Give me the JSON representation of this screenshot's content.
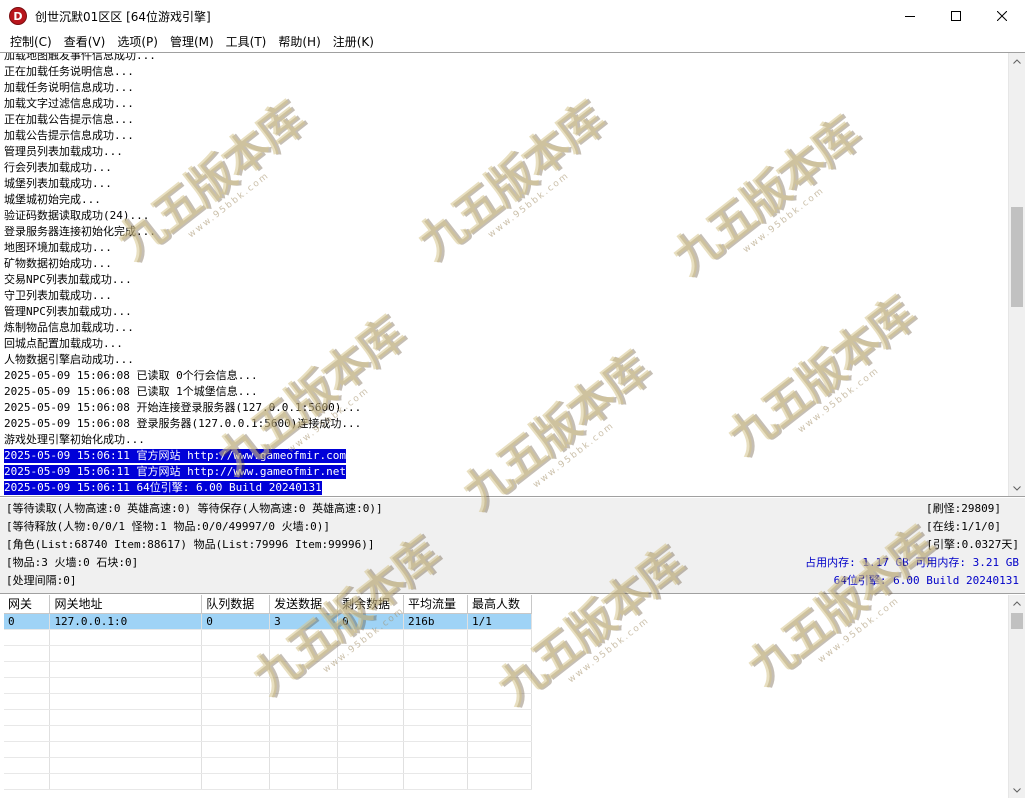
{
  "window": {
    "title": "创世沉默01区区 [64位游戏引擎]",
    "app_icon_glyph": "D"
  },
  "menu": [
    {
      "label": "控制(C)"
    },
    {
      "label": "查看(V)"
    },
    {
      "label": "选项(P)"
    },
    {
      "label": "管理(M)"
    },
    {
      "label": "工具(T)"
    },
    {
      "label": "帮助(H)"
    },
    {
      "label": "注册(K)"
    }
  ],
  "log": {
    "lines": [
      {
        "text": "加载地图触发事件信息成功...",
        "selected": false
      },
      {
        "text": "正在加载任务说明信息...",
        "selected": false
      },
      {
        "text": "加载任务说明信息成功...",
        "selected": false
      },
      {
        "text": "加载文字过滤信息成功...",
        "selected": false
      },
      {
        "text": "正在加载公告提示信息...",
        "selected": false
      },
      {
        "text": "加载公告提示信息成功...",
        "selected": false
      },
      {
        "text": "管理员列表加载成功...",
        "selected": false
      },
      {
        "text": "行会列表加载成功...",
        "selected": false
      },
      {
        "text": "城堡列表加载成功...",
        "selected": false
      },
      {
        "text": "城堡城初始完成...",
        "selected": false
      },
      {
        "text": "验证码数据读取成功(24)...",
        "selected": false
      },
      {
        "text": "登录服务器连接初始化完成...",
        "selected": false
      },
      {
        "text": "地图环境加载成功...",
        "selected": false
      },
      {
        "text": "矿物数据初始成功...",
        "selected": false
      },
      {
        "text": "交易NPC列表加载成功...",
        "selected": false
      },
      {
        "text": "守卫列表加载成功...",
        "selected": false
      },
      {
        "text": "管理NPC列表加载成功...",
        "selected": false
      },
      {
        "text": "炼制物品信息加载成功...",
        "selected": false
      },
      {
        "text": "回城点配置加载成功...",
        "selected": false
      },
      {
        "text": "人物数据引擎启动成功...",
        "selected": false
      },
      {
        "text": "2025-05-09 15:06:08 已读取 0个行会信息...",
        "selected": false
      },
      {
        "text": "2025-05-09 15:06:08 已读取 1个城堡信息...",
        "selected": false
      },
      {
        "text": "2025-05-09 15:06:08 开始连接登录服务器(127.0.0.1:5600)...",
        "selected": false
      },
      {
        "text": "2025-05-09 15:06:08 登录服务器(127.0.0.1:5600)连接成功...",
        "selected": false
      },
      {
        "text": "游戏处理引擎初始化成功...",
        "selected": false
      },
      {
        "text": "2025-05-09 15:06:11 官方网站 http://www.gameofmir.com",
        "selected": true
      },
      {
        "text": "2025-05-09 15:06:11 官方网站 http://www.gameofmir.net",
        "selected": true
      },
      {
        "text": "2025-05-09 15:06:11 64位引擎: 6.00 Build 20240131",
        "selected": true
      }
    ]
  },
  "status": {
    "row1_left": "[等待读取(人物高速:0 英雄高速:0) 等待保存(人物高速:0 英雄高速:0)]",
    "row2_left": "[等待释放(人物:0/0/1 怪物:1 物品:0/0/49997/0 火墙:0)]",
    "row3_left": "[角色(List:68740 Item:88617) 物品(List:79996 Item:99996)]",
    "row4_left": "[物品:3 火墙:0 石块:0]",
    "row5_left": "[处理间隔:0]",
    "row1_right": "[刷怪:29809]",
    "row2_right": "[在线:1/1/0]",
    "row3_right": "[引擎:0.0327天]",
    "row4_right": "占用内存: 1.17 GB 可用内存: 3.21 GB",
    "row5_right": "64位引擎: 6.00 Build 20240131"
  },
  "gateway_table": {
    "columns": [
      "网关",
      "网关地址",
      "队列数据",
      "发送数据",
      "剩余数据",
      "平均流量",
      "最高人数"
    ],
    "rows": [
      [
        "0",
        "127.0.0.1:0",
        "0",
        "3",
        "0",
        "216b",
        "1/1"
      ]
    ],
    "selected_row": 0
  },
  "watermark": {
    "text": "九五版本库",
    "url": "www.95bbk.com"
  },
  "colors": {
    "selection": "#0000d8",
    "grid_selection": "#9fd3f6",
    "status_blue": "#0000c8"
  }
}
